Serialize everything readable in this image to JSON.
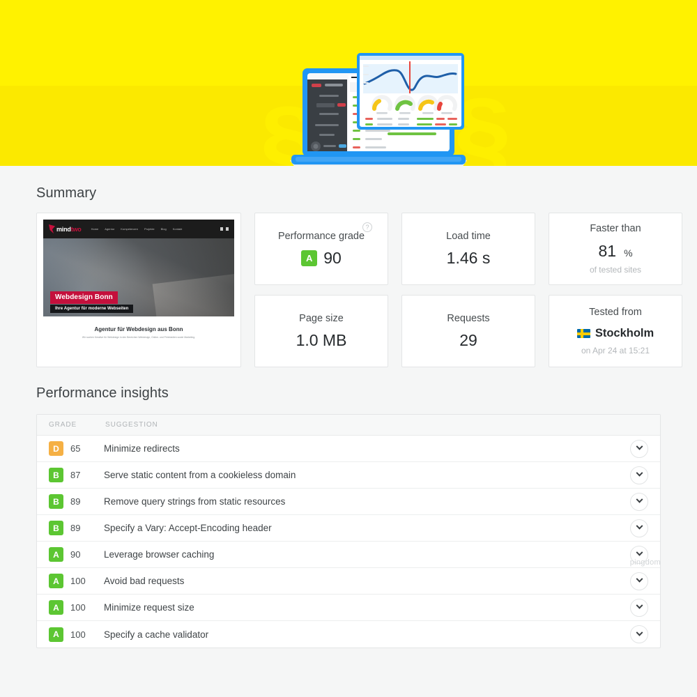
{
  "hero": {
    "illustration_name": "laptop-dashboard-illustration",
    "bg_top": "#fff200",
    "bg_bottom": "#fbe900"
  },
  "summary": {
    "title": "Summary",
    "thumbnail": {
      "logo_text_a": "mind",
      "logo_text_b": "two",
      "nav": [
        "Home",
        "Agentur",
        "Kompetenzen",
        "Projekte",
        "Blog",
        "Kontakt"
      ],
      "banner": "Webdesign Bonn",
      "subbanner": "Ihre Agentur für moderne Webseiten",
      "heading": "Agentur für Webdesign aus Bonn",
      "paragraph": "Wir suchen Kreative für Webdesign in den Bereichen Webdesign, Online- und Printmedien sowie Marketing."
    },
    "cards": [
      {
        "label": "Performance grade",
        "grade": "A",
        "grade_color": "#5cc632",
        "value": "90",
        "help": "?",
        "sub": ""
      },
      {
        "label": "Load time",
        "value": "1.46 s",
        "sub": ""
      },
      {
        "label": "Faster than",
        "value": "81",
        "unit": "%",
        "sub": "of tested sites"
      },
      {
        "label": "Page size",
        "value": "1.0 MB",
        "sub": ""
      },
      {
        "label": "Requests",
        "value": "29",
        "sub": ""
      },
      {
        "label": "Tested from",
        "location": "Stockholm",
        "flag": "sweden-flag-icon",
        "sub": "on Apr 24 at 15:21"
      }
    ],
    "watermark": "pingdom"
  },
  "insights": {
    "title": "Performance insights",
    "columns": {
      "grade": "GRADE",
      "suggestion": "SUGGESTION"
    },
    "rows": [
      {
        "grade": "D",
        "color": "#f5b044",
        "score": "65",
        "suggestion": "Minimize redirects"
      },
      {
        "grade": "B",
        "color": "#5cc632",
        "score": "87",
        "suggestion": "Serve static content from a cookieless domain"
      },
      {
        "grade": "B",
        "color": "#5cc632",
        "score": "89",
        "suggestion": "Remove query strings from static resources"
      },
      {
        "grade": "B",
        "color": "#5cc632",
        "score": "89",
        "suggestion": "Specify a Vary: Accept-Encoding header"
      },
      {
        "grade": "A",
        "color": "#5cc632",
        "score": "90",
        "suggestion": "Leverage browser caching"
      },
      {
        "grade": "A",
        "color": "#5cc632",
        "score": "100",
        "suggestion": "Avoid bad requests"
      },
      {
        "grade": "A",
        "color": "#5cc632",
        "score": "100",
        "suggestion": "Minimize request size"
      },
      {
        "grade": "A",
        "color": "#5cc632",
        "score": "100",
        "suggestion": "Specify a cache validator"
      }
    ]
  }
}
